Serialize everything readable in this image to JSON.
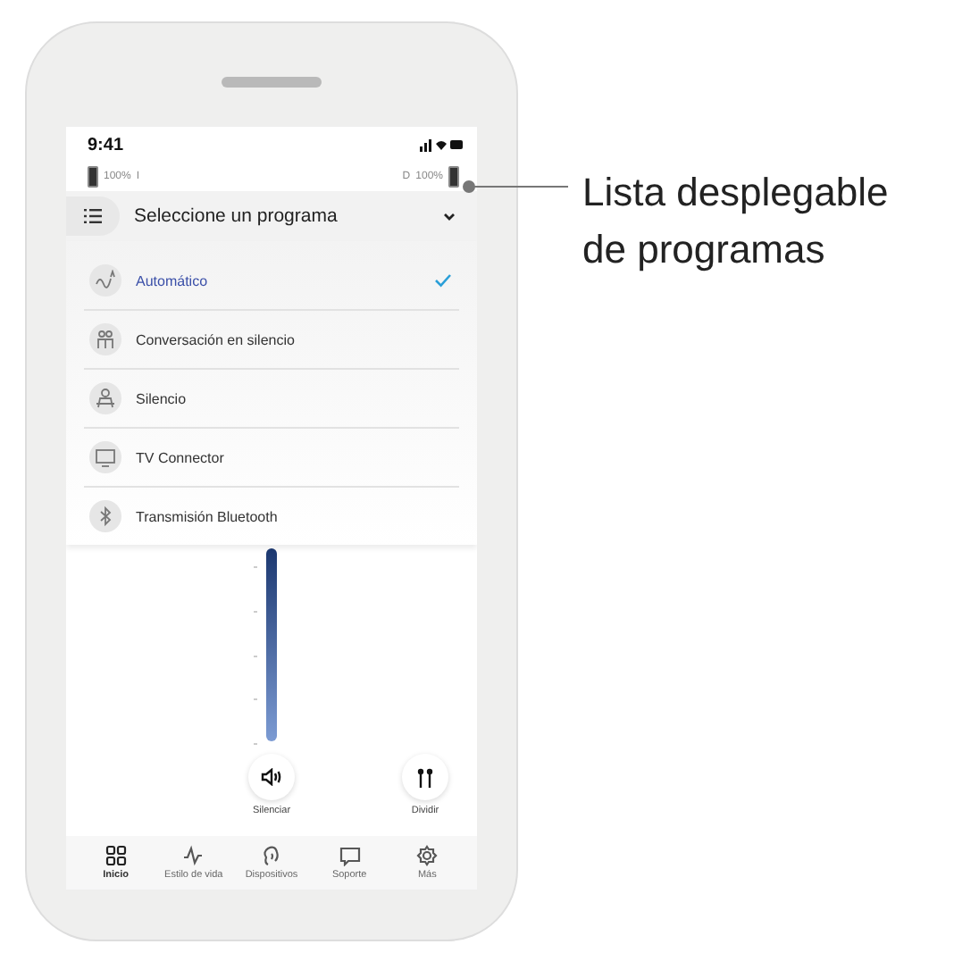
{
  "status_bar": {
    "time": "9:41"
  },
  "batteries": [
    {
      "percent": "100%",
      "label": "I"
    },
    {
      "percent": "100%",
      "label": "D"
    }
  ],
  "program_dropdown": {
    "title": "Seleccione un programa",
    "expanded": true,
    "items": [
      {
        "label": "Automático",
        "selected": true
      },
      {
        "label": "Conversación en silencio",
        "selected": false
      },
      {
        "label": "Silencio",
        "selected": false
      },
      {
        "label": "TV Connector",
        "selected": false
      },
      {
        "label": "Transmisión Bluetooth",
        "selected": false
      }
    ]
  },
  "actions": [
    {
      "label": "Silenciar"
    },
    {
      "label": "Dividir"
    }
  ],
  "tab_bar": [
    {
      "label": "Inicio",
      "selected": true
    },
    {
      "label": "Estilo de vida",
      "selected": false
    },
    {
      "label": "Dispositivos",
      "selected": false
    },
    {
      "label": "Soporte",
      "selected": false
    },
    {
      "label": "Más",
      "selected": false
    }
  ],
  "callout": {
    "text": "Lista desplegable de programas"
  }
}
